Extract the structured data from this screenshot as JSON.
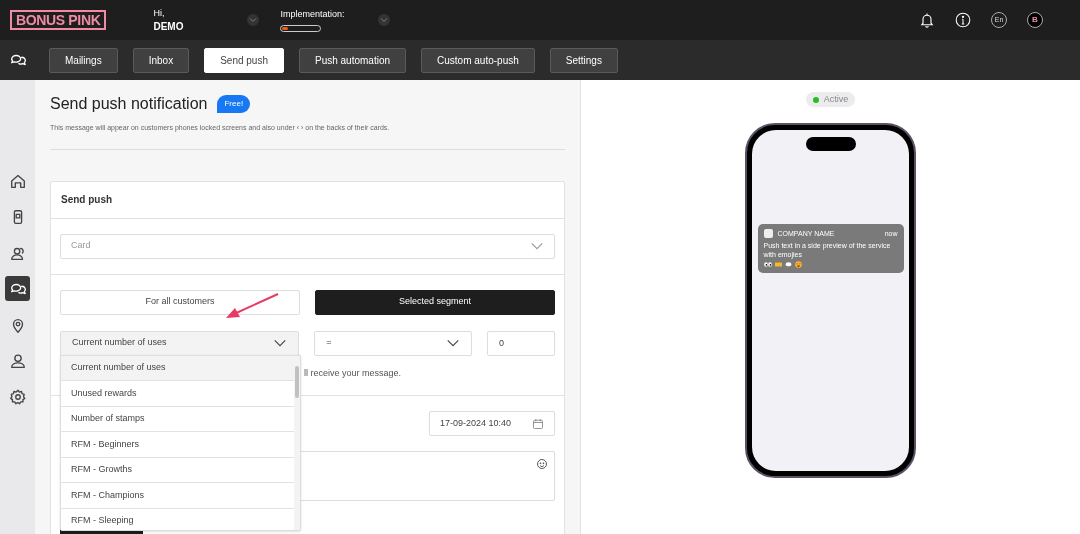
{
  "header": {
    "logo": "BONUS PINK",
    "greeting": "Hi,",
    "user": "DEMO",
    "implementation": {
      "label": "Implementation:",
      "level": 0.15
    },
    "language": "En",
    "avatar": "B"
  },
  "tabs": [
    {
      "label": "Mailings",
      "selected": false
    },
    {
      "label": "Inbox",
      "selected": false
    },
    {
      "label": "Send push",
      "selected": true
    },
    {
      "label": "Push automation",
      "selected": false
    },
    {
      "label": "Custom auto-push",
      "selected": false
    },
    {
      "label": "Settings",
      "selected": false
    }
  ],
  "sidebar": {
    "items": [
      {
        "selected": false
      },
      {
        "selected": false
      },
      {
        "selected": false
      },
      {
        "selected": true
      },
      {
        "selected": false
      },
      {
        "selected": false
      },
      {
        "selected": false
      }
    ]
  },
  "page": {
    "title": "Send push notification",
    "badge": "Free!",
    "description": "This message will appear on customers phones locked screens and also under ‹ › on the backs of their cards."
  },
  "form": {
    "title": "Send push",
    "card_placeholder": "Card",
    "audience": [
      {
        "label": "For all customers",
        "selected": false
      },
      {
        "label": "Selected segment",
        "selected": true
      }
    ],
    "filter": {
      "field": "Current number of uses",
      "operator": "=",
      "value": "0",
      "options": [
        {
          "label": "Current number of uses",
          "selected": true
        },
        {
          "label": "Unused rewards",
          "selected": false
        },
        {
          "label": "Number of stamps",
          "selected": false
        },
        {
          "label": "RFM - Beginners",
          "selected": false
        },
        {
          "label": "RFM - Growths",
          "selected": false
        },
        {
          "label": "RFM - Champions",
          "selected": false
        },
        {
          "label": "RFM - Sleeping",
          "selected": false
        }
      ]
    },
    "hint": "ll receive your message.",
    "date": "17-09-2024 10:40"
  },
  "preview": {
    "status": "Active",
    "active": true,
    "notification": {
      "app": "COMPANY NAME",
      "time": "now",
      "text": "Push text in a side preview of the service with emojies"
    }
  }
}
